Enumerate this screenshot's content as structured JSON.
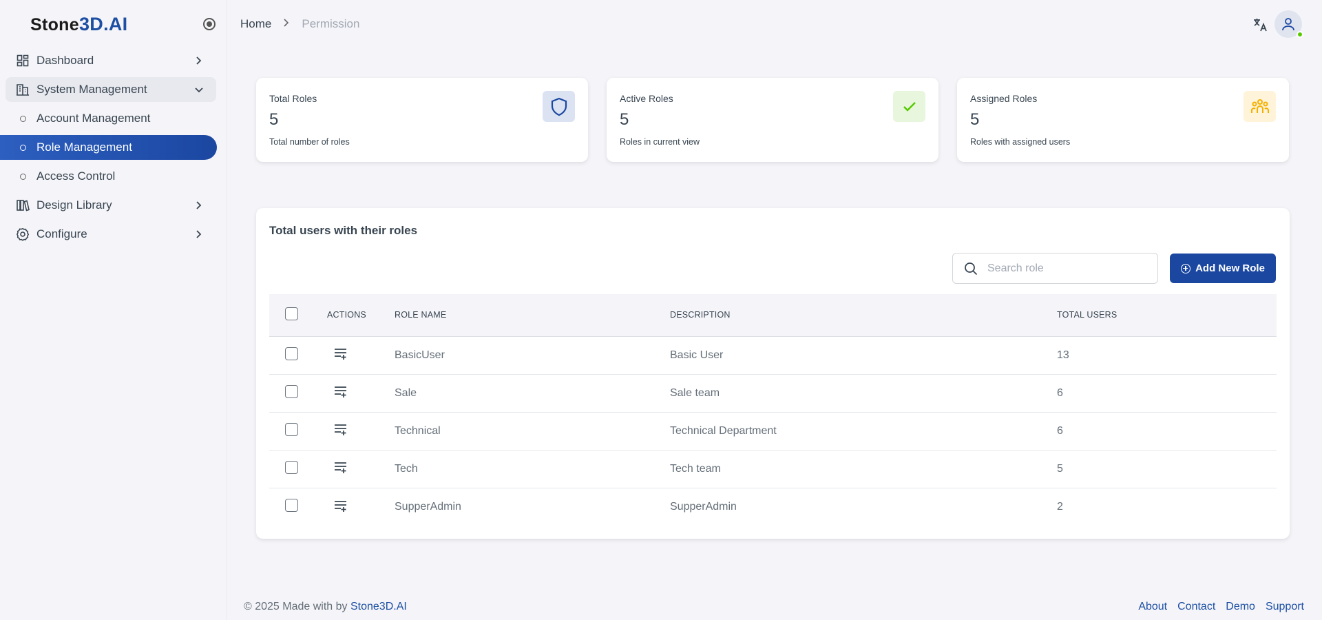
{
  "brand": {
    "logo_prefix": "Stone",
    "logo_highlight": "3D.AI"
  },
  "sidebar": {
    "items": [
      {
        "label": "Dashboard"
      },
      {
        "label": "System Management"
      },
      {
        "label": "Account Management"
      },
      {
        "label": "Role Management"
      },
      {
        "label": "Access Control"
      },
      {
        "label": "Design Library"
      },
      {
        "label": "Configure"
      }
    ],
    "active_item": "Role Management"
  },
  "breadcrumb": {
    "home": "Home",
    "current": "Permission"
  },
  "stats": [
    {
      "label": "Total Roles",
      "value": "5",
      "desc": "Total number of roles",
      "icon": "shield-icon",
      "color": "#1b47a1",
      "bg": "#dbe3f2"
    },
    {
      "label": "Active Roles",
      "value": "5",
      "desc": "Roles in current view",
      "icon": "check-icon",
      "color": "#56ca00",
      "bg": "#e7f6dc"
    },
    {
      "label": "Assigned Roles",
      "value": "5",
      "desc": "Roles with assigned users",
      "icon": "users-icon",
      "color": "#f4b000",
      "bg": "#fff3d9"
    }
  ],
  "roles_card": {
    "title": "Total users with their roles",
    "search_placeholder": "Search role",
    "add_button": "Add New Role",
    "columns": [
      "ACTIONS",
      "ROLE NAME",
      "DESCRIPTION",
      "TOTAL USERS"
    ],
    "rows": [
      {
        "name": "BasicUser",
        "description": "Basic User",
        "total_users": "13"
      },
      {
        "name": "Sale",
        "description": "Sale team",
        "total_users": "6"
      },
      {
        "name": "Technical",
        "description": "Technical Department",
        "total_users": "6"
      },
      {
        "name": "Tech",
        "description": "Tech team",
        "total_users": "5"
      },
      {
        "name": "SupperAdmin",
        "description": "SupperAdmin",
        "total_users": "2"
      }
    ]
  },
  "footer": {
    "copyright": "© 2025 Made with by ",
    "brand_link": "Stone3D.AI",
    "links": [
      "About",
      "Contact",
      "Demo",
      "Support"
    ]
  },
  "colors": {
    "primary": "#1b47a1",
    "background": "#f5f5f9",
    "online": "#56ca00"
  }
}
